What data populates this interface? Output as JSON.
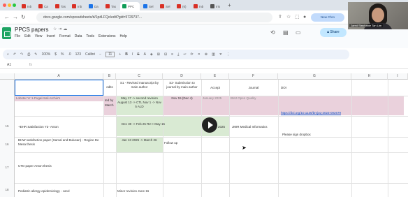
{
  "browser": {
    "tabs": [
      {
        "label": "Inb",
        "color": "#d93025"
      },
      {
        "label": "Ca",
        "color": "#d93025"
      },
      {
        "label": "Tas",
        "color": "#d93025"
      },
      {
        "label": "Inb",
        "color": "#d93025"
      },
      {
        "label": "Da",
        "color": "#1a73e8"
      },
      {
        "label": "Tas",
        "color": "#d93025"
      },
      {
        "label": "PPC",
        "color": "#0f9d58"
      },
      {
        "label": "Sel",
        "color": "#1a73e8"
      },
      {
        "label": "Sel",
        "color": "#d93025"
      },
      {
        "label": "(6)",
        "color": "#d93025"
      },
      {
        "label": "Inb",
        "color": "#d93025"
      },
      {
        "label": "Iris",
        "color": "#555555"
      }
    ],
    "new_tab_glyph": "+",
    "url": "docs.google.com/spreadsheets/d/1pdLFQo/edit?gid=5729737...",
    "new_chrome_label": "New Chro"
  },
  "sheet": {
    "title": "PPCS papers",
    "menu": [
      "File",
      "Edit",
      "View",
      "Insert",
      "Format",
      "Data",
      "Tools",
      "Extensions",
      "Help"
    ],
    "share_label": "Share",
    "zoom": "100%",
    "font": "Calibri",
    "font_size": "11",
    "cell_ref": "A1",
    "fx": "fx"
  },
  "video": {
    "name": "Jared Stephanie Tan Lim"
  },
  "grid": {
    "columns": [
      "A",
      "B",
      "C",
      "D",
      "E",
      "F",
      "G",
      "H",
      "I"
    ],
    "row_numbers": [
      "",
      "",
      "",
      "",
      "",
      "",
      "",
      "",
      "",
      "",
      "",
      ""
    ],
    "header_row": {
      "b": "edits",
      "c": "S1 - Revised manuscript by main author",
      "d": "S2- Submission to journal by main author",
      "e": "Accept",
      "f": "Journal",
      "g": "DOI"
    },
    "row_lobster": {
      "a": "Lobster Yr 1-Pugal-Sali Archie's",
      "b1": "ted by",
      "b2": "March",
      "c": "May 17 -> second revision August 13 -> CTL Nov 1 -> Nov 5 ALD",
      "d": "Nov 15 (Dec 4)",
      "e": "January 2025",
      "f": "BMJ Open Quality",
      "g": "https://doi.org/10.1136/bmjoq-2023-002679"
    },
    "row_ehr": {
      "num": "15",
      "a": "+EHR Satisfaction Y3- Anton",
      "c": "Dec 30 -> Feb 25 R2-> May 15",
      "e": "2025",
      "f": "JMIR Medical Informatics",
      "g": "Please sign dropbox"
    },
    "row_bhw": {
      "num": "16",
      "a": "BHW satisfaction paper (Samal and Bulusan) - Regine De Mesa thesis",
      "c": "Jan 13 2025 -> March 26",
      "d": "Follow up"
    },
    "row_utd": {
      "num": "17",
      "a": "UTD paper Anton thesis"
    },
    "row_allergy": {
      "num": "18",
      "a": "Pediatric allergy epidemiology - carol",
      "c": "Minor revision June 16"
    }
  },
  "colors": {
    "green_fill": "#d9ead3",
    "pink_fill": "#ead1dc",
    "selected_border": "#1a73e8",
    "tab_bar": "#dde3ea"
  }
}
